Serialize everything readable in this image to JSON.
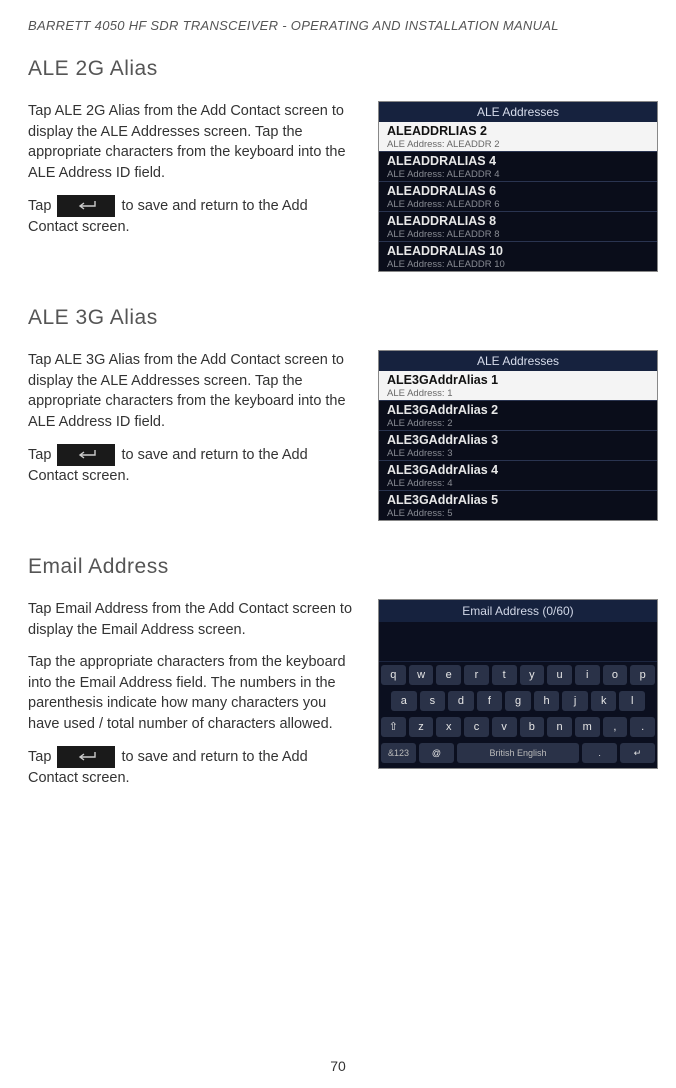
{
  "header": {
    "title": "BARRETT 4050 HF SDR TRANSCEIVER - OPERATING AND INSTALLATION MANUAL"
  },
  "page_number": "70",
  "sections": {
    "ale2g": {
      "heading": "ALE 2G Alias",
      "p1a": "Tap ",
      "p1b_strong": "ALE 2G Alias",
      "p1c": " from the Add Contact screen to display the ALE Addresses screen. Tap the appropriate characters from the keyboard into the ALE Address ID field.",
      "p2a": "Tap ",
      "p2b": " to save and return to the Add Contact screen.",
      "shot_title": "ALE Addresses",
      "rows": [
        {
          "main": "ALEADDRLIAS 2",
          "sub": "ALE Address: ALEADDR 2",
          "sel": true
        },
        {
          "main": "ALEADDRALIAS 4",
          "sub": "ALE Address: ALEADDR 4"
        },
        {
          "main": "ALEADDRALIAS 6",
          "sub": "ALE Address: ALEADDR 6"
        },
        {
          "main": "ALEADDRALIAS 8",
          "sub": "ALE Address: ALEADDR 8"
        },
        {
          "main": "ALEADDRALIAS 10",
          "sub": "ALE Address: ALEADDR 10"
        }
      ]
    },
    "ale3g": {
      "heading": "ALE 3G Alias",
      "p1a": "Tap ",
      "p1b_strong": "ALE 3G Alias",
      "p1c": " from the Add Contact screen to display the ALE Addresses screen. Tap the appropriate characters from the keyboard into the ALE Address ID field.",
      "p2a": "Tap ",
      "p2b": " to save and return to the Add Contact screen.",
      "shot_title": "ALE Addresses",
      "rows": [
        {
          "main": "ALE3GAddrAlias 1",
          "sub": "ALE Address: 1",
          "sel": true
        },
        {
          "main": "ALE3GAddrAlias 2",
          "sub": "ALE Address: 2"
        },
        {
          "main": "ALE3GAddrAlias 3",
          "sub": "ALE Address: 3"
        },
        {
          "main": "ALE3GAddrAlias 4",
          "sub": "ALE Address: 4"
        },
        {
          "main": "ALE3GAddrAlias 5",
          "sub": "ALE Address: 5"
        }
      ]
    },
    "email": {
      "heading": "Email Address",
      "p1a": "Tap ",
      "p1b_strong": "Email Address",
      "p1c": " from the Add Contact screen to display the Email Address screen.",
      "p2": "Tap the appropriate characters from the keyboard into the Email Address field. The numbers in the parenthesis indicate how many characters you have used / total number of characters allowed.",
      "p3a": "Tap ",
      "p3b": " to save and return to the Add Contact screen.",
      "shot_title": "Email Address (0/60)",
      "kbd": {
        "r1": [
          "q",
          "w",
          "e",
          "r",
          "t",
          "y",
          "u",
          "i",
          "o",
          "p"
        ],
        "r2": [
          "a",
          "s",
          "d",
          "f",
          "g",
          "h",
          "j",
          "k",
          "l"
        ],
        "r3": [
          "⇧",
          "z",
          "x",
          "c",
          "v",
          "b",
          "n",
          "m",
          ",",
          "."
        ],
        "r4_left": "&123",
        "r4_at": "@",
        "r4_space": "British English",
        "r4_dot": ".",
        "r4_enter": "↵"
      }
    }
  }
}
